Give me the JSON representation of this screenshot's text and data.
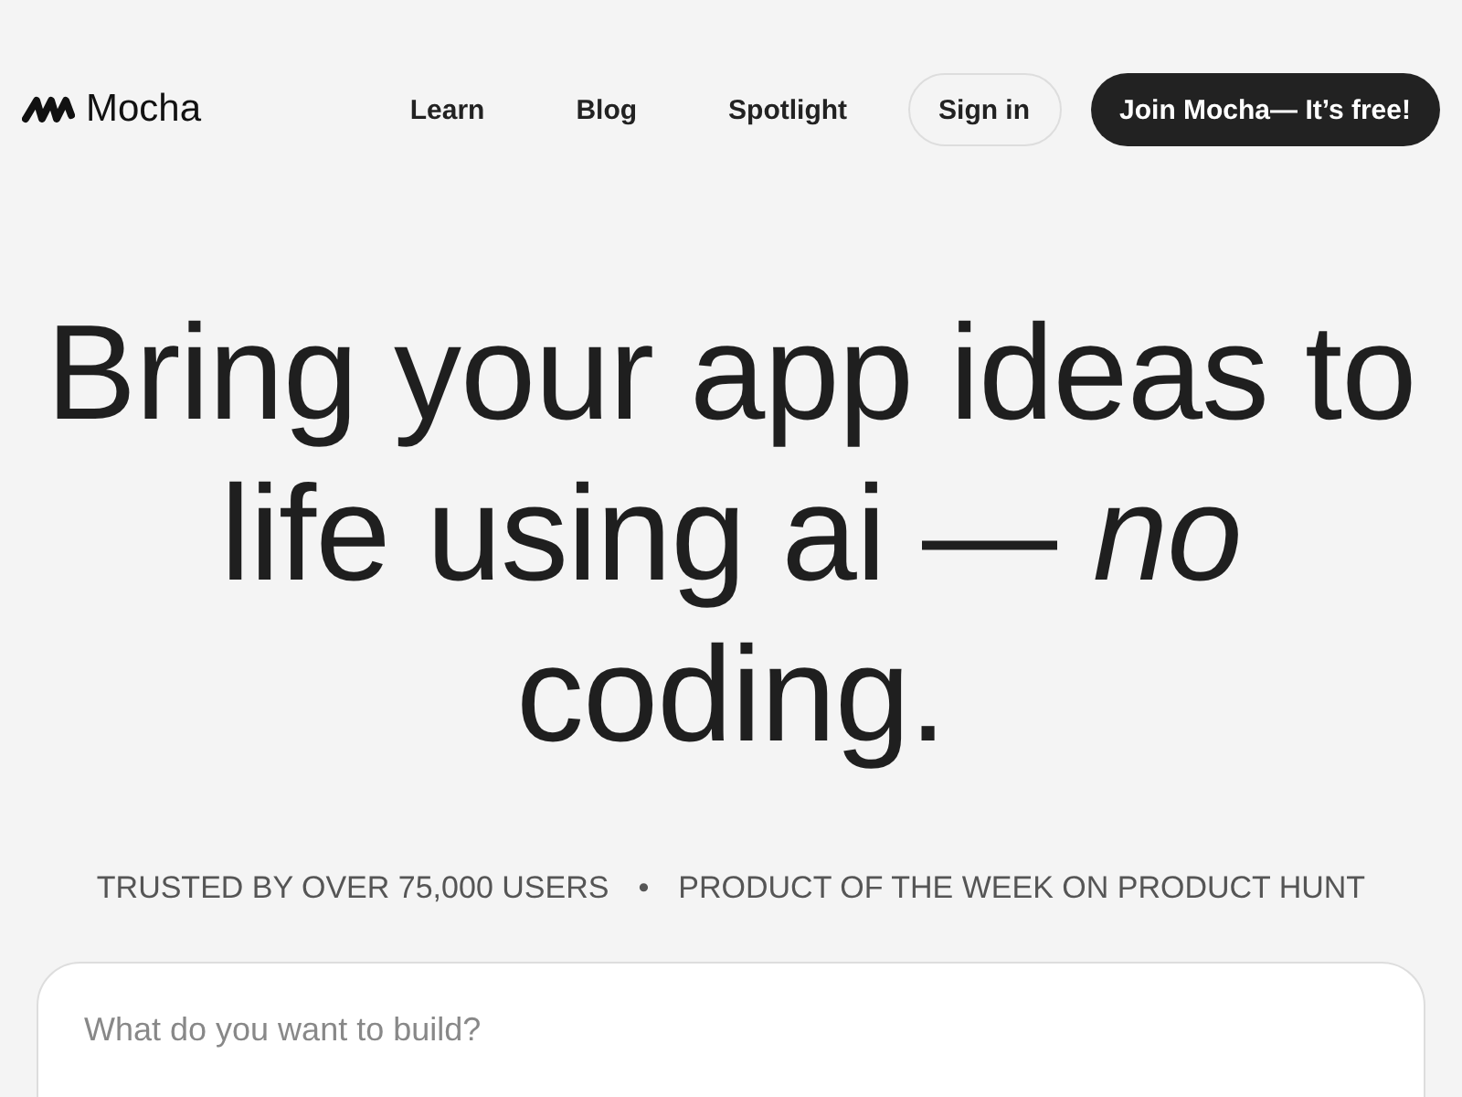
{
  "brand": {
    "name": "Mocha"
  },
  "nav": [
    {
      "label": "Learn"
    },
    {
      "label": "Blog"
    },
    {
      "label": "Spotlight"
    }
  ],
  "sign_in": "Sign in",
  "cta": "Join Mocha— It’s free!",
  "headline": "Bring your app ideas to life using ai — *no* coding.",
  "trust": [
    "TRUSTED BY OVER 75,000 USERS",
    "PRODUCT OF THE WEEK ON PRODUCT HUNT"
  ],
  "trust_separator": "•",
  "prompt": {
    "placeholder": "What do you want to build?"
  }
}
